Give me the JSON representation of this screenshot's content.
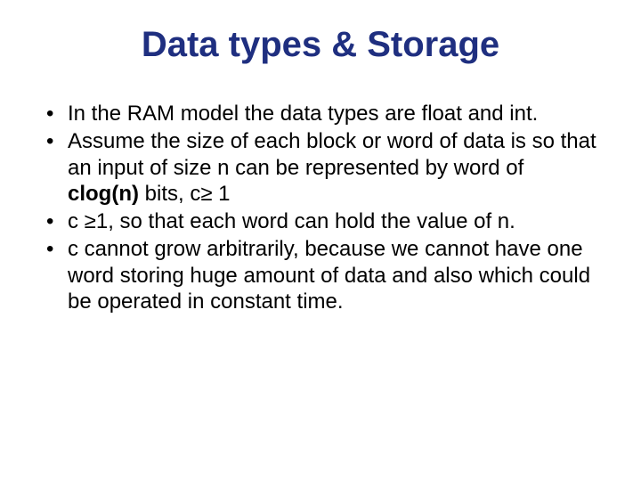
{
  "title": "Data types & Storage",
  "bullets": [
    {
      "pre": "In the RAM model the data types are float and int.",
      "bold": "",
      "post": ""
    },
    {
      "pre": "Assume the size of each block or word of data is so that an input of size n can be represented by word of ",
      "bold": "clog(n)",
      "post": " bits, c≥ 1"
    },
    {
      "pre": "c ≥1, so that each word can hold the value of n.",
      "bold": "",
      "post": ""
    },
    {
      "pre": "c cannot grow arbitrarily, because we cannot have one word storing huge amount of data and also which could be operated in constant time.",
      "bold": "",
      "post": ""
    }
  ]
}
